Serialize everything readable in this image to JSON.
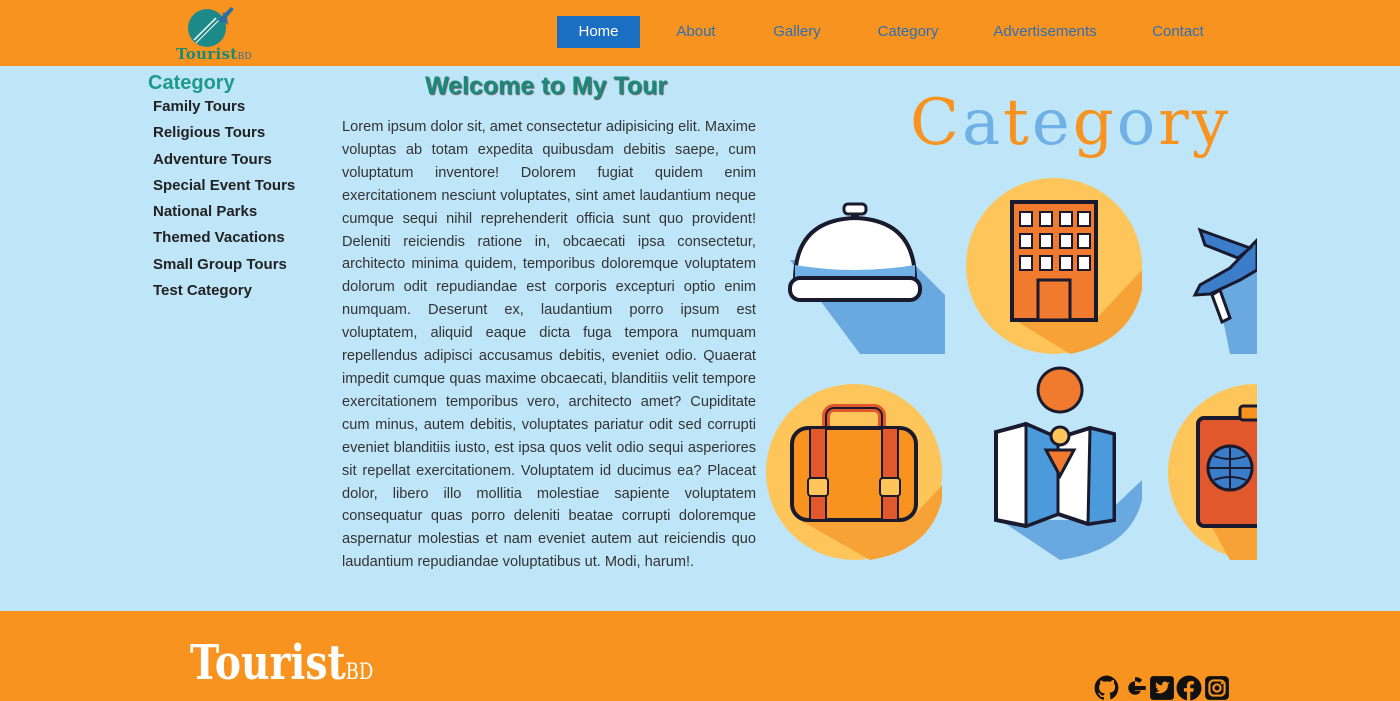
{
  "header": {
    "logo_text": "Tourist",
    "logo_sub": "BD",
    "nav": [
      "Home",
      "About",
      "Gallery",
      "Category",
      "Advertisements",
      "Contact"
    ],
    "active": "Home"
  },
  "sidebar": {
    "title": "Category",
    "items": [
      "Family Tours",
      "Religious Tours",
      "Adventure Tours",
      "Special Event Tours",
      "National Parks",
      "Themed Vacations",
      "Small Group Tours",
      "Test Category"
    ]
  },
  "main": {
    "title": "Welcome to My Tour",
    "body": "Lorem ipsum dolor sit, amet consectetur adipisicing elit. Maxime voluptas ab totam expedita quibusdam debitis saepe, cum voluptatum inventore! Dolorem fugiat quidem enim exercitationem nesciunt voluptates, sint amet laudantium neque cumque sequi nihil reprehenderit officia sunt quo provident! Deleniti reiciendis ratione in, obcaecati ipsa consectetur, architecto minima quidem, temporibus doloremque voluptatem dolorum odit repudiandae est corporis excepturi optio enim numquam. Deserunt ex, laudantium porro ipsum est voluptatem, aliquid eaque dicta fuga tempora numquam repellendus adipisci accusamus debitis, eveniet odio. Quaerat impedit cumque quas maxime obcaecati, blanditiis velit tempore exercitationem temporibus vero, architecto amet? Cupiditate cum minus, autem debitis, voluptates pariatur odit sed corrupti eveniet blanditiis iusto, est ipsa quos velit odio sequi asperiores sit repellat exercitationem. Voluptatem id ducimus ea? Placeat dolor, libero illo mollitia molestiae sapiente voluptatem consequatur quas porro deleniti beatae corrupti doloremque aspernatur molestias et nam eveniet autem aut reiciendis quo laudantium repudiandae voluptatibus ut. Modi, harum!."
  },
  "image": {
    "word": "Category",
    "icons": [
      "bell-icon",
      "hotel-icon",
      "airplane-icon",
      "suitcase-icon",
      "map-icon",
      "passport-icon"
    ]
  },
  "footer": {
    "brand": "Tourist",
    "brand_sub": "BD",
    "socials": [
      "github-icon",
      "google-icon",
      "twitter-icon",
      "facebook-icon",
      "instagram-icon"
    ]
  },
  "colors": {
    "header_bg": "#f7931e",
    "page_bg": "#bfe6f8",
    "nav_active": "#1a6fc2",
    "accent_teal": "#1e9a8a"
  }
}
